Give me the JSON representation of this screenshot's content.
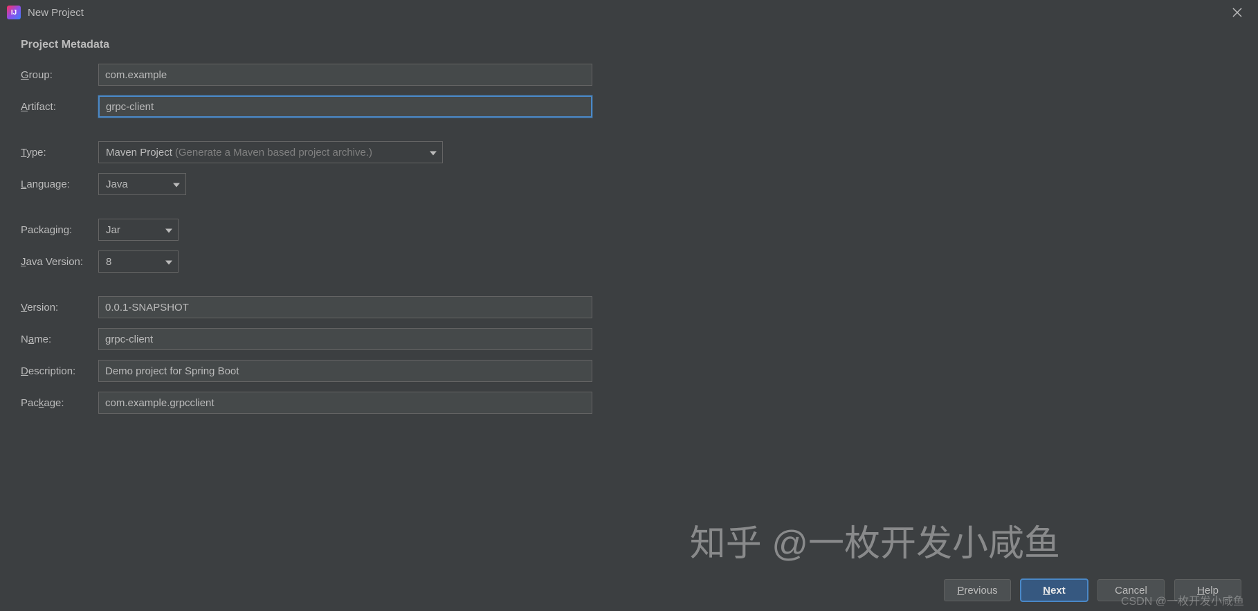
{
  "window": {
    "title": "New Project"
  },
  "section": {
    "header": "Project Metadata"
  },
  "labels": {
    "group": "roup:",
    "artifact": "rtifact:",
    "type": "ype:",
    "language": "anguage:",
    "packaging": "Packaging:",
    "javaVersion": "ava Version:",
    "version": "ersion:",
    "name": "me:",
    "description": "escription:",
    "package": "age:"
  },
  "fields": {
    "group": "com.example",
    "artifact": "grpc-client",
    "type": "Maven Project",
    "type_hint": "(Generate a Maven based project archive.)",
    "language": "Java",
    "packaging": "Jar",
    "javaVersion": "8",
    "version": "0.0.1-SNAPSHOT",
    "name": "grpc-client",
    "description": "Demo project for Spring Boot",
    "package": "com.example.grpcclient"
  },
  "buttons": {
    "previous": "revious",
    "next": "ext",
    "cancel": "Cancel",
    "help": "elp"
  },
  "watermarks": {
    "zhihu": "知乎 @一枚开发小咸鱼",
    "csdn": "CSDN @一枚开发小咸鱼"
  }
}
